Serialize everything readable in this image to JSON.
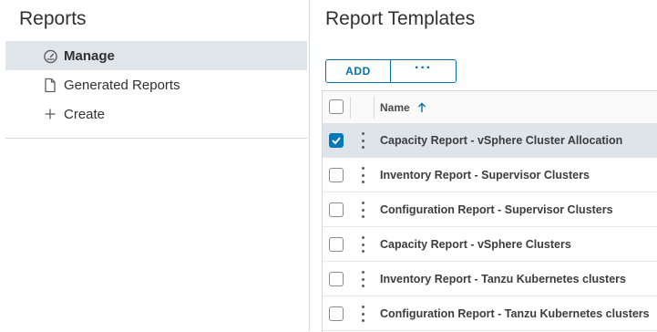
{
  "sidebar": {
    "title": "Reports",
    "items": [
      {
        "label": "Manage",
        "icon": "dashboard-gauge-icon",
        "active": true
      },
      {
        "label": "Generated Reports",
        "icon": "document-icon",
        "active": false
      },
      {
        "label": "Create",
        "icon": "plus-icon",
        "active": false
      }
    ]
  },
  "main": {
    "title": "Report Templates",
    "toolbar": {
      "add_label": "ADD",
      "more_label": "···"
    },
    "table": {
      "columns": {
        "name": "Name",
        "sort": "ascending"
      },
      "rows": [
        {
          "name": "Capacity Report - vSphere Cluster Allocation",
          "checked": true
        },
        {
          "name": "Inventory Report - Supervisor Clusters",
          "checked": false
        },
        {
          "name": "Configuration Report - Supervisor Clusters",
          "checked": false
        },
        {
          "name": "Capacity Report - vSphere Clusters",
          "checked": false
        },
        {
          "name": "Inventory Report - Tanzu Kubernetes clusters",
          "checked": false
        },
        {
          "name": "Configuration Report - Tanzu Kubernetes clusters",
          "checked": false
        }
      ]
    }
  },
  "colors": {
    "accent": "#0072a3",
    "checkbox_checked": "#0079b8",
    "selected_row": "#dde4ea",
    "active_nav": "#dfe5ea"
  }
}
